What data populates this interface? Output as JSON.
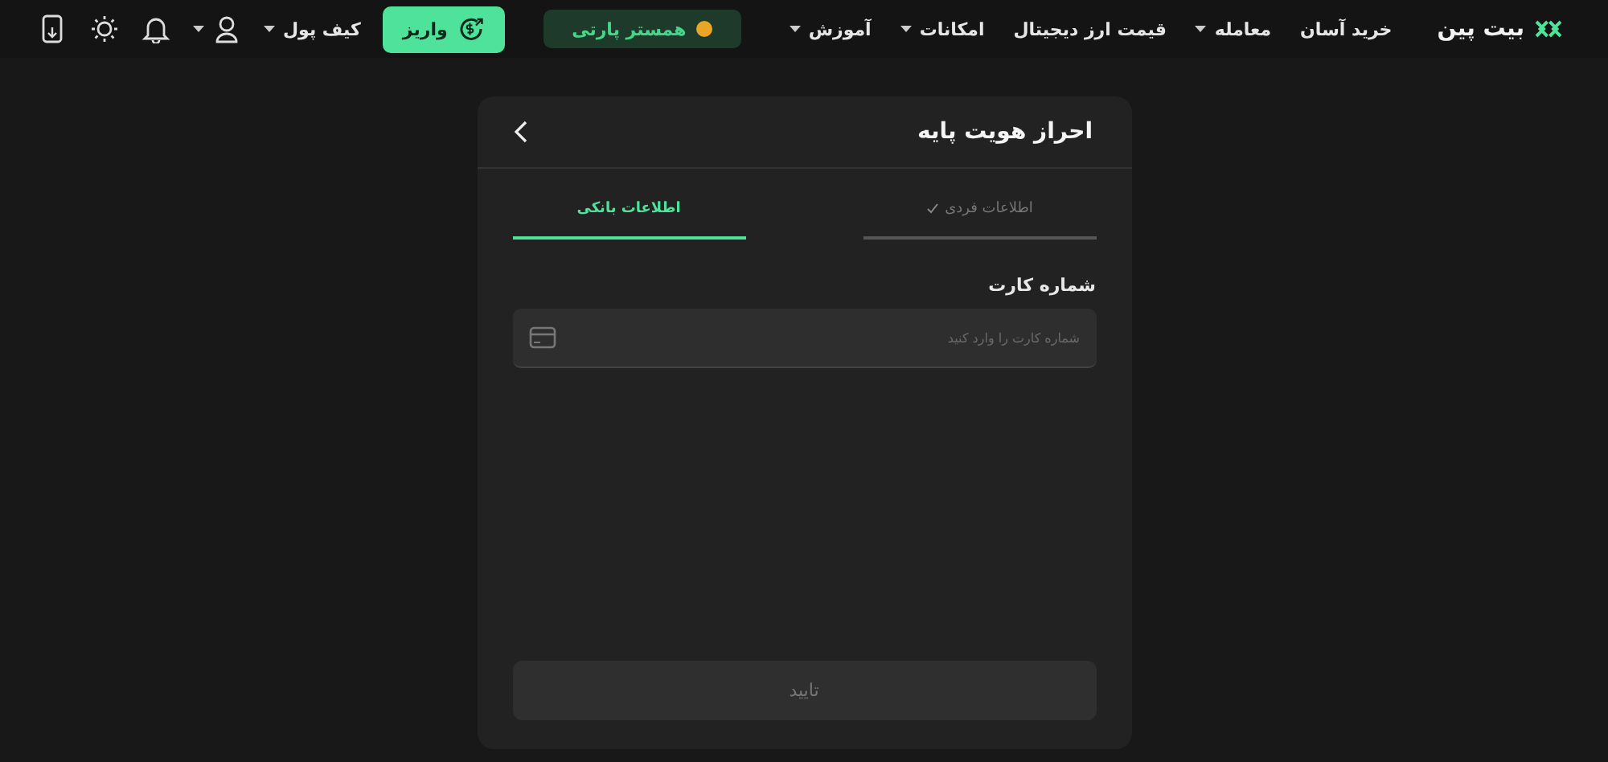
{
  "header": {
    "logo": "بیت پین",
    "nav": [
      {
        "label": "خرید آسان",
        "dropdown": false
      },
      {
        "label": "معامله",
        "dropdown": true
      },
      {
        "label": "قیمت ارز دیجیتال",
        "dropdown": false
      },
      {
        "label": "امکانات",
        "dropdown": true
      },
      {
        "label": "آموزش",
        "dropdown": true
      }
    ],
    "party_button": "همستر پارتی",
    "deposit_button": "واریز",
    "wallet": {
      "label": "کیف پول",
      "dropdown": true
    }
  },
  "panel": {
    "title": "احراز هویت پایه",
    "steps": [
      {
        "label": "اطلاعات فردی",
        "done": true,
        "selected": false
      },
      {
        "label": "اطلاعات بانکی",
        "done": false,
        "selected": true
      }
    ],
    "field": {
      "label": "شماره کارت",
      "placeholder": "شماره کارت را وارد کنید"
    },
    "submit": {
      "label": "تایید",
      "disabled": true
    }
  }
}
